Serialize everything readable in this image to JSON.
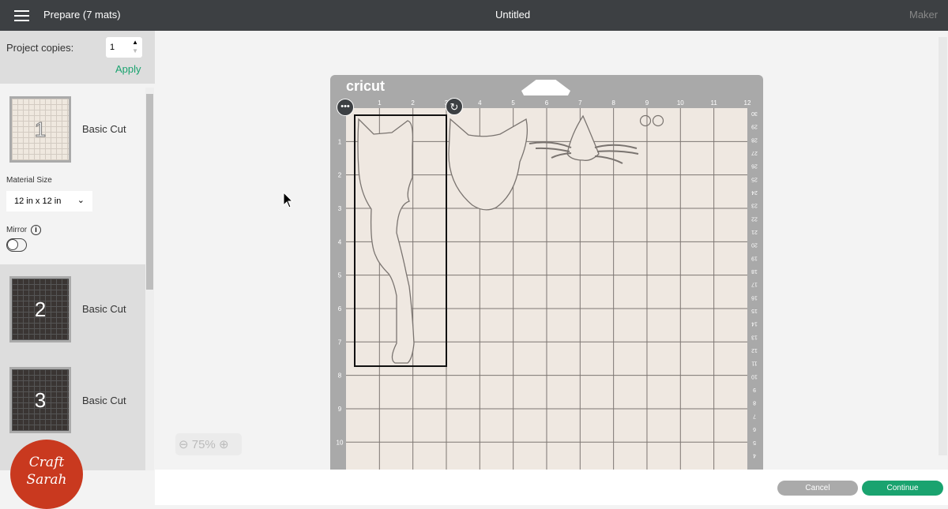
{
  "header": {
    "title": "Prepare (7 mats)",
    "document": "Untitled",
    "machine": "Maker"
  },
  "sidebar": {
    "copies_label": "Project copies:",
    "copies_value": "1",
    "apply": "Apply",
    "mats": [
      {
        "number": "1",
        "label": "Basic Cut"
      },
      {
        "number": "2",
        "label": "Basic Cut"
      },
      {
        "number": "3",
        "label": "Basic Cut"
      }
    ],
    "material_size_label": "Material Size",
    "material_size": "12 in x 12 in",
    "mirror_label": "Mirror",
    "mirror_on": false
  },
  "mat": {
    "brand": "cricut",
    "top_ruler": [
      "1",
      "2",
      "3",
      "4",
      "5",
      "6",
      "7",
      "8",
      "9",
      "10",
      "11",
      "12"
    ],
    "left_ruler": [
      "1",
      "2",
      "3",
      "4",
      "5",
      "6",
      "7",
      "8",
      "9",
      "10"
    ],
    "right_ruler": [
      "30",
      "29",
      "28",
      "27",
      "26",
      "25",
      "24",
      "23",
      "22",
      "21",
      "20",
      "19",
      "18",
      "17",
      "16",
      "15",
      "14",
      "13",
      "12",
      "11",
      "10",
      "9",
      "8",
      "7",
      "6",
      "5",
      "4"
    ]
  },
  "zoom": {
    "value": "75%"
  },
  "footer": {
    "cancel": "Cancel",
    "continue": "Continue"
  },
  "logo": {
    "text": "Craft with Sarah"
  },
  "colors": {
    "accent": "#1aa36f",
    "header": "#3d4043"
  }
}
